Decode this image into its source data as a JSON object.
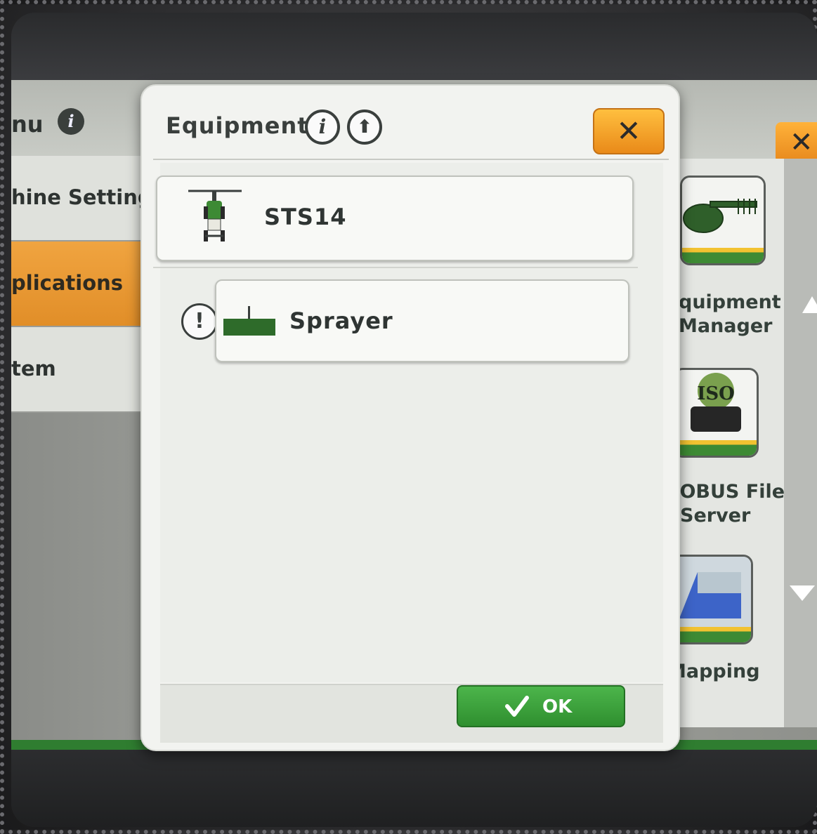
{
  "background_app": {
    "menu_title_fragment": "nu",
    "list_items": [
      {
        "label": "hine Setting",
        "active": false
      },
      {
        "label": "plications",
        "active": true
      },
      {
        "label": "tem",
        "active": false
      }
    ],
    "apps": [
      {
        "label_line1": "quipment",
        "label_line2": "Manager",
        "icon": "disk-harrow-icon"
      },
      {
        "label_line1": "SOBUS File",
        "label_line2": "Server",
        "icon": "iso-server-icon"
      },
      {
        "label_line1": "Mapping",
        "label_line2": "",
        "icon": "map-icon"
      }
    ],
    "iso_badge": "ISO"
  },
  "dialog": {
    "title": "Equipment",
    "info_icon": "info-icon",
    "help_icon": "help-up-arrow-icon",
    "close_symbol": "✕",
    "items": [
      {
        "label": "STS14",
        "icon": "sprayer-tractor-icon",
        "warning": false
      },
      {
        "label": "Sprayer",
        "icon": "boom-sprayer-icon",
        "warning": true
      }
    ],
    "warning_symbol": "!",
    "ok_label": "OK"
  },
  "colors": {
    "accent_orange": "#e98a19",
    "ok_green": "#2f8f2f",
    "john_deere_green": "#367c2b"
  }
}
